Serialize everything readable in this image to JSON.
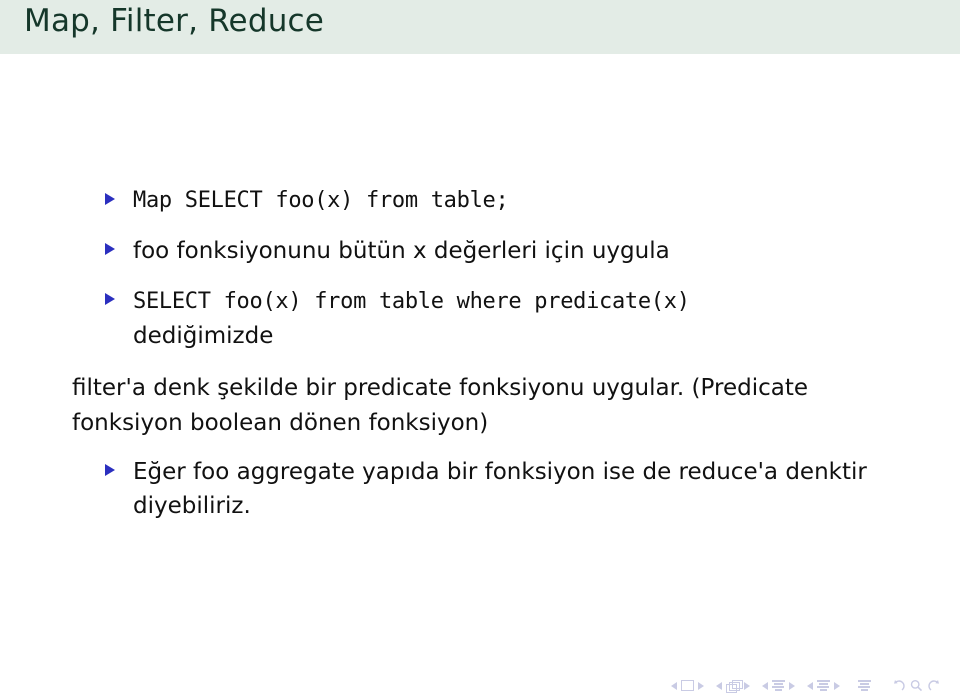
{
  "slide": {
    "title": "Map, Filter, Reduce",
    "title_color": "#15372a",
    "header_bg": "#e3ece6",
    "bullet_marker_color": "#2b2fbf",
    "body_text_color": "#111111",
    "nav_color": "#c9cbe4"
  },
  "content": {
    "bullets": [
      {
        "level": 1,
        "style": "mono",
        "text": "Map SELECT foo(x) from table;",
        "continuation": ""
      },
      {
        "level": 1,
        "style": "sans",
        "text": "foo fonksiyonunu bütün x değerleri için uygula",
        "continuation": ""
      },
      {
        "level": 1,
        "style": "mono",
        "text": "SELECT foo(x) from table where predicate(x)",
        "continuation": "dediğimizde"
      }
    ],
    "paragraph": "filter'a denk şekilde bir predicate fonksiyonu uygular. (Predicate fonksiyon boolean dönen fonksiyon)",
    "final_bullet": {
      "level": 1,
      "style": "sans",
      "text": "Eğer foo aggregate yapıda bir fonksiyon ise de reduce'a denktir diyebiliriz."
    }
  },
  "navigation": {
    "groups": [
      {
        "name": "slide-navigation",
        "icon": "slide-icon",
        "prev": "◂",
        "next": "▸"
      },
      {
        "name": "frame-navigation",
        "icon": "frames-icon",
        "prev": "◂",
        "next": "▸"
      },
      {
        "name": "subsection-navigation",
        "icon": "lines-icon",
        "prev": "◂",
        "next": "▸"
      },
      {
        "name": "section-navigation",
        "icon": "lines-icon",
        "prev": "◂",
        "next": "▸"
      }
    ],
    "presentation_icon": "lines-icon",
    "back_icon": "back-arrow-icon",
    "search_icon": "search-icon",
    "forward_icon": "forward-arrow-icon"
  }
}
